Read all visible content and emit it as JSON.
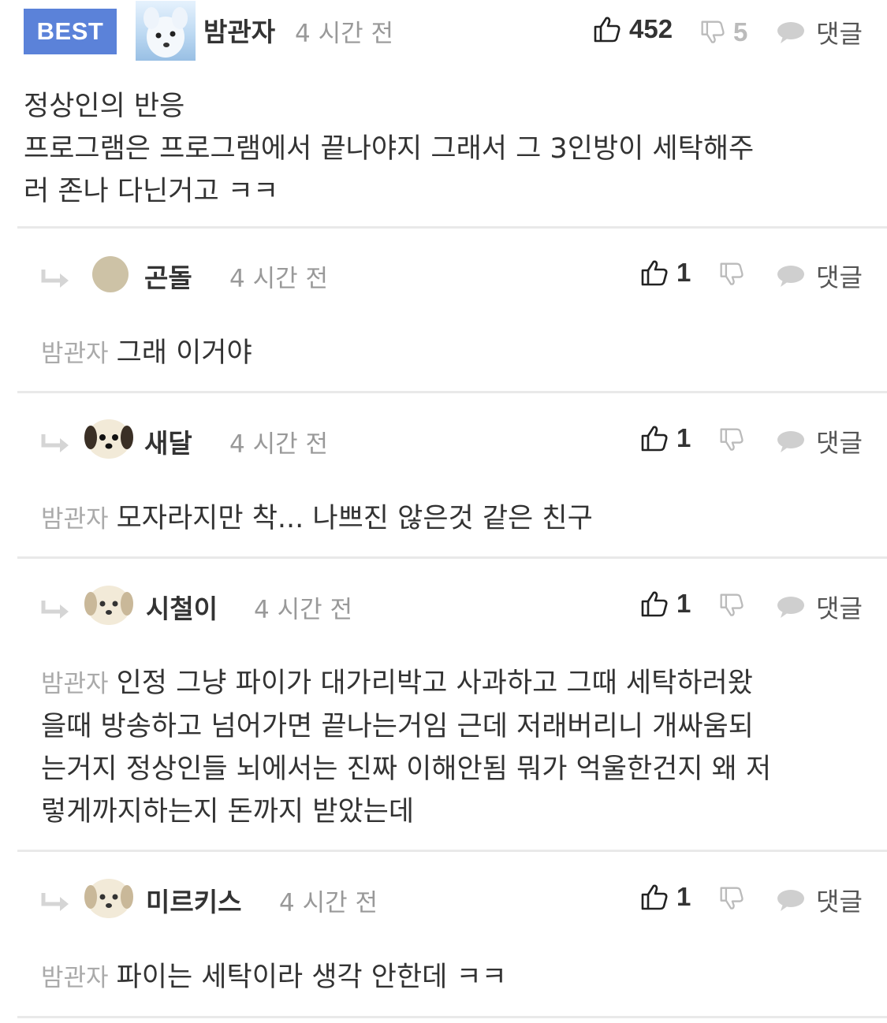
{
  "best_comment": {
    "badge": "BEST",
    "author": "밤관자",
    "time": "4 시간 전",
    "likes": "452",
    "dislikes": "5",
    "reply_label": "댓글",
    "body_lines": [
      "정상인의 반응",
      "프로그램은 프로그램에서 끝나야지 그래서 그 3인방이 세탁해주",
      "러 존나 다닌거고 ㅋㅋ"
    ]
  },
  "replies": [
    {
      "author": "곤돌",
      "time": "4 시간 전",
      "likes": "1",
      "reply_label": "댓글",
      "mention": "밤관자",
      "body_lines": [
        "그래 이거야"
      ]
    },
    {
      "author": "새달",
      "time": "4 시간 전",
      "likes": "1",
      "reply_label": "댓글",
      "mention": "밤관자",
      "body_lines": [
        "모자라지만 착... 나쁘진 않은것 같은 친구"
      ]
    },
    {
      "author": "시철이",
      "time": "4 시간 전",
      "likes": "1",
      "reply_label": "댓글",
      "mention": "밤관자",
      "body_lines": [
        "인정 그냥 파이가 대가리박고 사과하고 그때 세탁하러왔",
        "을때 방송하고 넘어가면 끝나는거임 근데 저래버리니 개싸움되",
        "는거지 정상인들 뇌에서는 진짜 이해안됨 뭐가 억울한건지 왜 저",
        "렇게까지하는지 돈까지 받았는데"
      ]
    },
    {
      "author": "미르키스",
      "time": "4 시간 전",
      "likes": "1",
      "reply_label": "댓글",
      "mention": "밤관자",
      "body_lines": [
        "파이는 세탁이라 생각 안한데 ㅋㅋ"
      ]
    }
  ],
  "colors": {
    "best_badge": "#5b82d9",
    "divider": "#e9e9e9",
    "muted_text": "#999999"
  },
  "icons": {
    "like": "thumbs-up-icon",
    "dislike": "thumbs-down-icon",
    "reply": "speech-bubble-icon",
    "reply_indent": "reply-arrow-icon"
  }
}
